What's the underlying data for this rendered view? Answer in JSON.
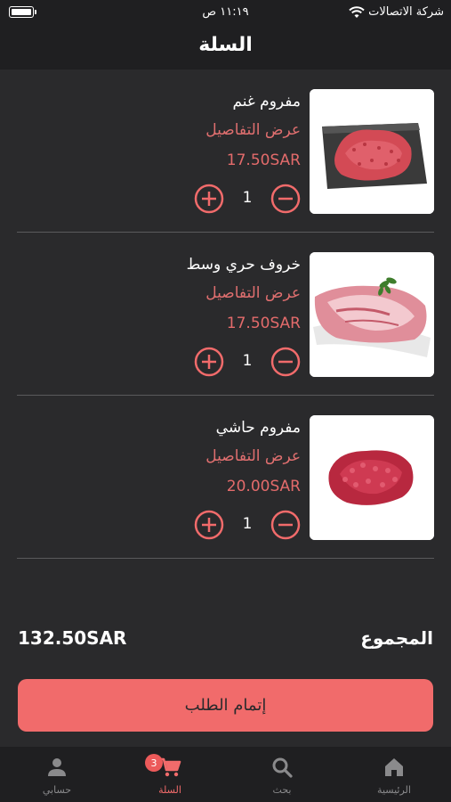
{
  "status_bar": {
    "time": "١١:١٩ ص",
    "carrier": "شركة الاتصالات"
  },
  "header": {
    "title": "السلة"
  },
  "colors": {
    "accent": "#f16b6b",
    "price": "#e36b6b",
    "background": "#2a2a2c",
    "bar": "#1f1f21"
  },
  "cart": {
    "items": [
      {
        "name": "مفروم غنم",
        "details": "عرض التفاصيل",
        "price": "17.50SAR",
        "quantity": "1",
        "image": "minced-meat-on-slate"
      },
      {
        "name": "خروف حري وسط",
        "details": "عرض التفاصيل",
        "price": "17.50SAR",
        "quantity": "1",
        "image": "lamb-shoulder-on-tray"
      },
      {
        "name": "مفروم حاشي",
        "details": "عرض التفاصيل",
        "price": "20.00SAR",
        "quantity": "1",
        "image": "minced-camel-meat"
      }
    ]
  },
  "summary": {
    "total_label": "المجموع",
    "total_value": "132.50SAR",
    "checkout_label": "إتمام الطلب"
  },
  "tabbar": {
    "home": "الرئيسية",
    "search": "بحث",
    "cart": "السلة",
    "account": "حسابي",
    "cart_badge": "3"
  },
  "icons": {
    "plus": "plus-circle-icon",
    "minus": "minus-circle-icon",
    "home": "home-icon",
    "search": "search-icon",
    "cart": "cart-icon",
    "account": "person-icon"
  }
}
